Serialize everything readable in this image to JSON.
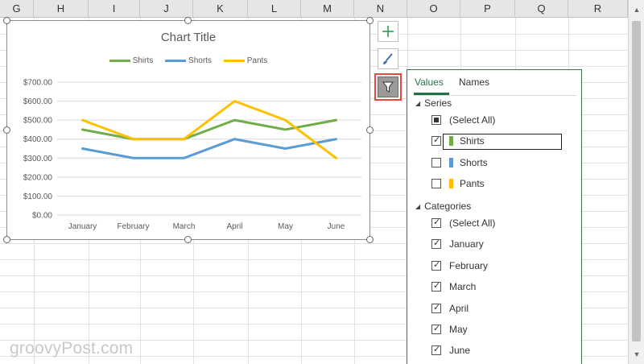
{
  "columns": [
    "G",
    "H",
    "I",
    "J",
    "K",
    "L",
    "M",
    "N",
    "O",
    "P",
    "Q",
    "R"
  ],
  "chart_data": {
    "type": "line",
    "title": "Chart Title",
    "categories": [
      "January",
      "February",
      "March",
      "April",
      "May",
      "June"
    ],
    "series": [
      {
        "name": "Shirts",
        "color": "#70ad47",
        "values": [
          450,
          400,
          400,
          500,
          450,
          500
        ]
      },
      {
        "name": "Shorts",
        "color": "#5b9bd5",
        "values": [
          350,
          300,
          300,
          400,
          350,
          400
        ]
      },
      {
        "name": "Pants",
        "color": "#ffc000",
        "values": [
          500,
          400,
          400,
          600,
          500,
          300
        ]
      }
    ],
    "y_ticks": [
      "$0.00",
      "$100.00",
      "$200.00",
      "$300.00",
      "$400.00",
      "$500.00",
      "$600.00",
      "$700.00"
    ],
    "ylim": [
      0,
      700
    ],
    "grid": true,
    "legend": "top"
  },
  "side_buttons": {
    "elements_icon": "plus-icon",
    "styles_icon": "brush-icon",
    "filter_icon": "funnel-icon"
  },
  "filter_panel": {
    "tabs": [
      "Values",
      "Names"
    ],
    "series_header": "Series",
    "series_items": [
      {
        "label": "(Select All)",
        "state": "partial"
      },
      {
        "label": "Shirts",
        "state": "checked",
        "color": "#70ad47"
      },
      {
        "label": "Shorts",
        "state": "unchecked",
        "color": "#5b9bd5"
      },
      {
        "label": "Pants",
        "state": "unchecked",
        "color": "#ffc000"
      }
    ],
    "categories_header": "Categories",
    "category_items": [
      {
        "label": "(Select All)",
        "state": "checked"
      },
      {
        "label": "January",
        "state": "checked"
      },
      {
        "label": "February",
        "state": "checked"
      },
      {
        "label": "March",
        "state": "checked"
      },
      {
        "label": "April",
        "state": "checked"
      },
      {
        "label": "May",
        "state": "checked"
      },
      {
        "label": "June",
        "state": "checked"
      }
    ]
  },
  "watermark": "groovyPost.com"
}
